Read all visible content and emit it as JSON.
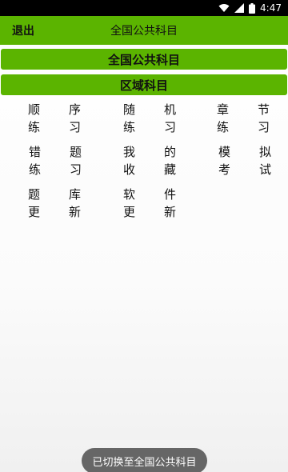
{
  "status_bar": {
    "time": "4:47"
  },
  "header": {
    "back_label": "退出",
    "title": "全国公共科目"
  },
  "categories": [
    {
      "label": "全国公共科目"
    },
    {
      "label": "区域科目"
    }
  ],
  "menu": [
    {
      "line1": [
        "顺",
        "序"
      ],
      "line2": [
        "练",
        "习"
      ]
    },
    {
      "line1": [
        "随",
        "机"
      ],
      "line2": [
        "练",
        "习"
      ]
    },
    {
      "line1": [
        "章",
        "节"
      ],
      "line2": [
        "练",
        "习"
      ]
    },
    {
      "line1": [
        "错",
        "题"
      ],
      "line2": [
        "练",
        "习"
      ]
    },
    {
      "line1": [
        "我",
        "的"
      ],
      "line2": [
        "收",
        "藏"
      ]
    },
    {
      "line1": [
        "模",
        "拟"
      ],
      "line2": [
        "考",
        "试"
      ]
    },
    {
      "line1": [
        "题",
        "库"
      ],
      "line2": [
        "更",
        "新"
      ]
    },
    {
      "line1": [
        "软",
        "件"
      ],
      "line2": [
        "更",
        "新"
      ]
    }
  ],
  "toast": {
    "message": "已切换至全国公共科目"
  }
}
